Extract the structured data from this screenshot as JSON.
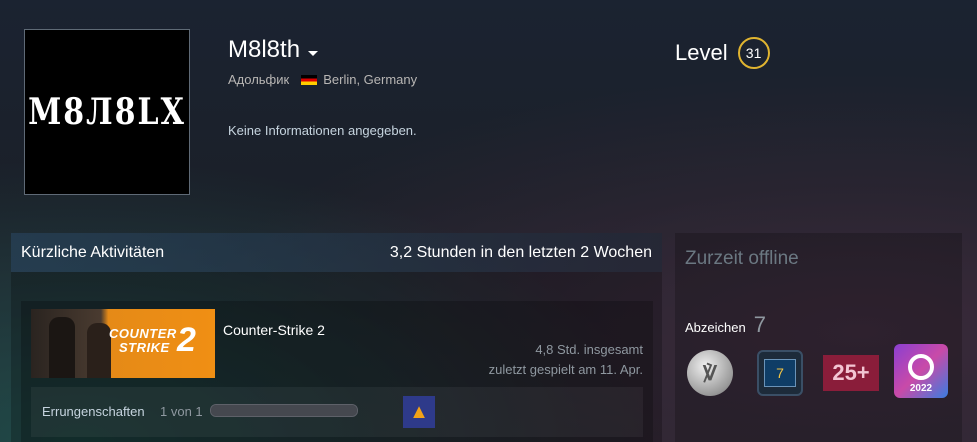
{
  "profile": {
    "avatar_text": "M8Л8LX",
    "persona_name": "M8l8th",
    "real_name": "Адольфик",
    "location": "Berlin, Germany",
    "summary": "Keine Informationen angegeben.",
    "level_label": "Level",
    "level_value": "31"
  },
  "activity": {
    "title": "Kürzliche Aktivitäten",
    "recent_hours": "3,2 Stunden in den letzten 2 Wochen",
    "game": {
      "name": "Counter-Strike 2",
      "capsule_line1": "COUNTER",
      "capsule_line2": "STRIKE",
      "capsule_number": "2",
      "hours_total": "4,8 Std. insgesamt",
      "last_played": "zuletzt gespielt am 11. Apr.",
      "achievements_label": "Errungenschaften",
      "achievements_count": "1 von 1",
      "achievements_progress": 1.0
    }
  },
  "sidebar": {
    "status": "Zurzeit offline",
    "badges_label": "Abzeichen",
    "badges_count": "7",
    "badges": [
      {
        "name": "silver-coin-badge"
      },
      {
        "name": "level-7-badge",
        "text": "7"
      },
      {
        "name": "25-plus-badge",
        "text": "25+"
      },
      {
        "name": "steam-2022-badge",
        "text": "2022"
      }
    ]
  },
  "colors": {
    "level_ring": "#e0b430",
    "capsule_orange": "#f08f14"
  }
}
